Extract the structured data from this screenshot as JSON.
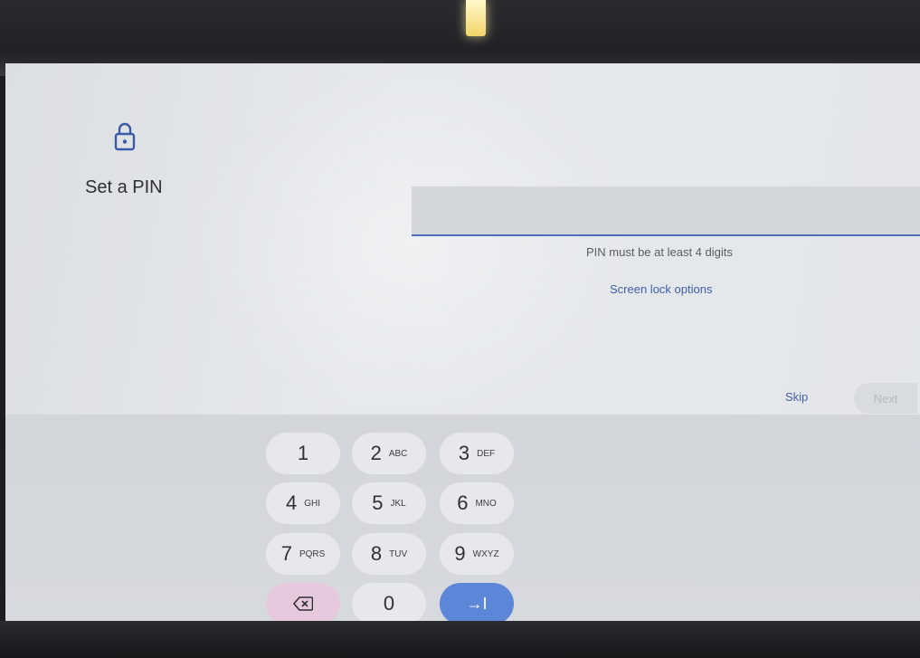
{
  "title": "Set a PIN",
  "pin_field": {
    "value": ""
  },
  "hint": "PIN must be at least 4 digits",
  "screen_lock_options": "Screen lock options",
  "skip": "Skip",
  "next": "Next",
  "keypad": [
    {
      "num": "1",
      "letters": ""
    },
    {
      "num": "2",
      "letters": "ABC"
    },
    {
      "num": "3",
      "letters": "DEF"
    },
    {
      "num": "4",
      "letters": "GHI"
    },
    {
      "num": "5",
      "letters": "JKL"
    },
    {
      "num": "6",
      "letters": "MNO"
    },
    {
      "num": "7",
      "letters": "PQRS"
    },
    {
      "num": "8",
      "letters": "TUV"
    },
    {
      "num": "9",
      "letters": "WXYZ"
    },
    {
      "num": "0",
      "letters": ""
    }
  ],
  "enter_key": "→I",
  "icons": {
    "lock": "lock-icon",
    "backspace": "backspace-icon",
    "enter": "enter-icon"
  },
  "colors": {
    "accent": "#4f6db8",
    "enter_key": "#5c87d8",
    "backspace_key": "#e7c9df"
  }
}
